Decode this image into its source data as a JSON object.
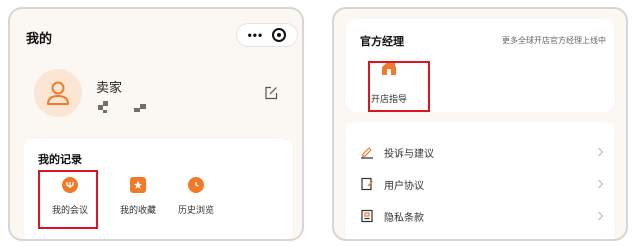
{
  "left_screen": {
    "nav_title": "我的",
    "capsule": {
      "more_icon": "more-dots-icon",
      "close_icon": "target-circle-icon"
    },
    "profile": {
      "avatar_icon": "user-avatar-icon",
      "name": "卖家",
      "edit_icon": "edit-icon"
    },
    "records": {
      "title": "我的记录",
      "items": [
        {
          "label": "我的会议",
          "icon": "meeting-icon",
          "highlighted": true
        },
        {
          "label": "我的收藏",
          "icon": "star-favorite-icon"
        },
        {
          "label": "历史浏览",
          "icon": "clock-history-icon"
        }
      ]
    }
  },
  "right_screen": {
    "manager": {
      "title": "官方经理",
      "more_text": "更多全球开店官方经理上线中",
      "item": {
        "label": "开店指导",
        "icon": "store-guide-icon",
        "highlighted": true
      }
    },
    "list": [
      {
        "label": "投诉与建议",
        "icon": "feedback-pen-icon"
      },
      {
        "label": "用户协议",
        "icon": "agreement-doc-icon"
      },
      {
        "label": "隐私条款",
        "icon": "privacy-doc-icon"
      }
    ]
  },
  "colors": {
    "accent": "#f07a2a",
    "highlight": "#e0141e",
    "page_background": "#fbf7f2"
  }
}
